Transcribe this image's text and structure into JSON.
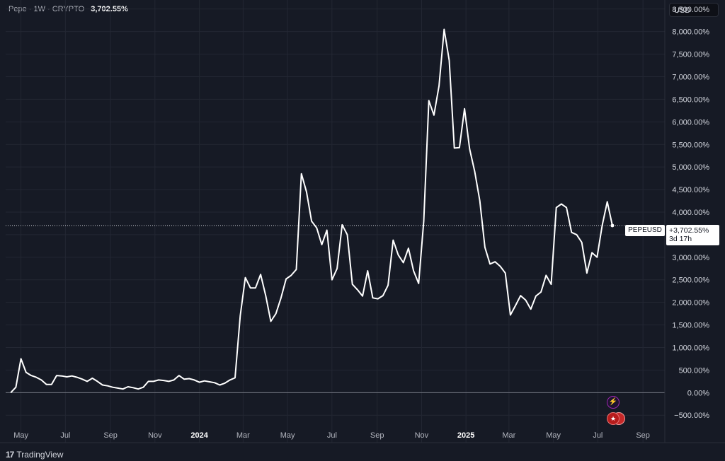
{
  "header": {
    "symbol": "Pepe · 1W · CRYPTO",
    "value": "3,702.55%"
  },
  "currency_button": "USD",
  "footer": {
    "logo_glyph": "17",
    "brand": "TradingView"
  },
  "price_tag": {
    "symbol": "PEPEUSD",
    "value": "+3,702.55%",
    "countdown": "3d 17h"
  },
  "colors": {
    "background": "#161a25",
    "line": "#ffffff",
    "grid": "#232733",
    "zero_line": "#787b86"
  },
  "events": {
    "event1_icon": "lightning-icon",
    "event2_icon": "us-flag-icon"
  },
  "chart_data": {
    "type": "line",
    "ylim": [
      -700,
      8700
    ],
    "y_ticks": [
      -500,
      0,
      500,
      1000,
      1500,
      2000,
      2500,
      3000,
      3500,
      4000,
      4500,
      5000,
      5500,
      6000,
      6500,
      7000,
      7500,
      8000,
      8500
    ],
    "y_tick_labels": [
      "−500.00%",
      "0.00%",
      "500.00%",
      "1,000.00%",
      "1,500.00%",
      "2,000.00%",
      "2,500.00%",
      "3,000.00%",
      "3,500.00%",
      "4,000.00%",
      "4,500.00%",
      "5,000.00%",
      "5,500.00%",
      "6,000.00%",
      "6,500.00%",
      "7,000.00%",
      "7,500.00%",
      "8,000.00%",
      "8,500.00%"
    ],
    "x_ticks": [
      {
        "label": "May",
        "bold": false,
        "date": "2023-05-01"
      },
      {
        "label": "Jul",
        "bold": false,
        "date": "2023-07-01"
      },
      {
        "label": "Sep",
        "bold": false,
        "date": "2023-09-01"
      },
      {
        "label": "Nov",
        "bold": false,
        "date": "2023-11-01"
      },
      {
        "label": "2024",
        "bold": true,
        "date": "2024-01-01"
      },
      {
        "label": "Mar",
        "bold": false,
        "date": "2024-03-01"
      },
      {
        "label": "May",
        "bold": false,
        "date": "2024-05-01"
      },
      {
        "label": "Jul",
        "bold": false,
        "date": "2024-07-01"
      },
      {
        "label": "Sep",
        "bold": false,
        "date": "2024-09-01"
      },
      {
        "label": "Nov",
        "bold": false,
        "date": "2024-11-01"
      },
      {
        "label": "2025",
        "bold": true,
        "date": "2025-01-01"
      },
      {
        "label": "Mar",
        "bold": false,
        "date": "2025-03-01"
      },
      {
        "label": "May",
        "bold": false,
        "date": "2025-05-01"
      },
      {
        "label": "Jul",
        "bold": false,
        "date": "2025-07-01"
      },
      {
        "label": "Sep",
        "bold": false,
        "date": "2025-09-01"
      }
    ],
    "xlim": [
      "2023-04-10",
      "2025-10-01"
    ],
    "last_value": 3702.55,
    "series": [
      {
        "points": [
          [
            "2023-04-17",
            0
          ],
          [
            "2023-04-24",
            120
          ],
          [
            "2023-05-01",
            750
          ],
          [
            "2023-05-08",
            450
          ],
          [
            "2023-05-15",
            380
          ],
          [
            "2023-05-22",
            340
          ],
          [
            "2023-05-29",
            280
          ],
          [
            "2023-06-05",
            180
          ],
          [
            "2023-06-12",
            180
          ],
          [
            "2023-06-19",
            380
          ],
          [
            "2023-06-26",
            370
          ],
          [
            "2023-07-03",
            350
          ],
          [
            "2023-07-10",
            370
          ],
          [
            "2023-07-17",
            340
          ],
          [
            "2023-07-24",
            300
          ],
          [
            "2023-07-31",
            250
          ],
          [
            "2023-08-07",
            320
          ],
          [
            "2023-08-14",
            250
          ],
          [
            "2023-08-21",
            170
          ],
          [
            "2023-08-28",
            150
          ],
          [
            "2023-09-04",
            120
          ],
          [
            "2023-09-11",
            100
          ],
          [
            "2023-09-18",
            80
          ],
          [
            "2023-09-25",
            130
          ],
          [
            "2023-10-02",
            110
          ],
          [
            "2023-10-09",
            80
          ],
          [
            "2023-10-16",
            120
          ],
          [
            "2023-10-23",
            250
          ],
          [
            "2023-10-30",
            250
          ],
          [
            "2023-11-06",
            280
          ],
          [
            "2023-11-13",
            270
          ],
          [
            "2023-11-20",
            250
          ],
          [
            "2023-11-27",
            280
          ],
          [
            "2023-12-04",
            380
          ],
          [
            "2023-12-11",
            300
          ],
          [
            "2023-12-18",
            310
          ],
          [
            "2023-12-25",
            280
          ],
          [
            "2024-01-01",
            230
          ],
          [
            "2024-01-08",
            260
          ],
          [
            "2024-01-15",
            240
          ],
          [
            "2024-01-22",
            220
          ],
          [
            "2024-01-29",
            170
          ],
          [
            "2024-02-05",
            210
          ],
          [
            "2024-02-12",
            280
          ],
          [
            "2024-02-19",
            330
          ],
          [
            "2024-02-26",
            1700
          ],
          [
            "2024-03-04",
            2550
          ],
          [
            "2024-03-11",
            2320
          ],
          [
            "2024-03-18",
            2320
          ],
          [
            "2024-03-25",
            2620
          ],
          [
            "2024-04-01",
            2150
          ],
          [
            "2024-04-08",
            1580
          ],
          [
            "2024-04-15",
            1750
          ],
          [
            "2024-04-22",
            2100
          ],
          [
            "2024-04-29",
            2520
          ],
          [
            "2024-05-06",
            2600
          ],
          [
            "2024-05-13",
            2730
          ],
          [
            "2024-05-20",
            4850
          ],
          [
            "2024-05-27",
            4450
          ],
          [
            "2024-06-03",
            3800
          ],
          [
            "2024-06-10",
            3650
          ],
          [
            "2024-06-17",
            3280
          ],
          [
            "2024-06-24",
            3600
          ],
          [
            "2024-07-01",
            2500
          ],
          [
            "2024-07-08",
            2750
          ],
          [
            "2024-07-15",
            3720
          ],
          [
            "2024-07-22",
            3500
          ],
          [
            "2024-07-29",
            2400
          ],
          [
            "2024-08-05",
            2280
          ],
          [
            "2024-08-12",
            2140
          ],
          [
            "2024-08-19",
            2700
          ],
          [
            "2024-08-26",
            2100
          ],
          [
            "2024-09-02",
            2080
          ],
          [
            "2024-09-09",
            2150
          ],
          [
            "2024-09-16",
            2380
          ],
          [
            "2024-09-23",
            3380
          ],
          [
            "2024-09-30",
            3050
          ],
          [
            "2024-10-07",
            2880
          ],
          [
            "2024-10-14",
            3200
          ],
          [
            "2024-10-21",
            2700
          ],
          [
            "2024-10-28",
            2420
          ],
          [
            "2024-11-04",
            3800
          ],
          [
            "2024-11-11",
            6470
          ],
          [
            "2024-11-18",
            6150
          ],
          [
            "2024-11-25",
            6800
          ],
          [
            "2024-12-02",
            8050
          ],
          [
            "2024-12-09",
            7360
          ],
          [
            "2024-12-16",
            5420
          ],
          [
            "2024-12-23",
            5430
          ],
          [
            "2024-12-30",
            6290
          ],
          [
            "2025-01-06",
            5400
          ],
          [
            "2025-01-13",
            4900
          ],
          [
            "2025-01-20",
            4250
          ],
          [
            "2025-01-27",
            3220
          ],
          [
            "2025-02-03",
            2850
          ],
          [
            "2025-02-10",
            2900
          ],
          [
            "2025-02-17",
            2800
          ],
          [
            "2025-02-24",
            2650
          ],
          [
            "2025-03-03",
            1720
          ],
          [
            "2025-03-10",
            1930
          ],
          [
            "2025-03-17",
            2150
          ],
          [
            "2025-03-24",
            2050
          ],
          [
            "2025-03-31",
            1850
          ],
          [
            "2025-04-07",
            2140
          ],
          [
            "2025-04-14",
            2230
          ],
          [
            "2025-04-21",
            2600
          ],
          [
            "2025-04-28",
            2400
          ],
          [
            "2025-05-05",
            4100
          ],
          [
            "2025-05-12",
            4180
          ],
          [
            "2025-05-19",
            4100
          ],
          [
            "2025-05-26",
            3550
          ],
          [
            "2025-06-02",
            3500
          ],
          [
            "2025-06-09",
            3330
          ],
          [
            "2025-06-16",
            2650
          ],
          [
            "2025-06-23",
            3100
          ],
          [
            "2025-06-30",
            3000
          ],
          [
            "2025-07-07",
            3700
          ],
          [
            "2025-07-14",
            4230
          ],
          [
            "2025-07-21",
            3702.55
          ]
        ]
      }
    ]
  }
}
